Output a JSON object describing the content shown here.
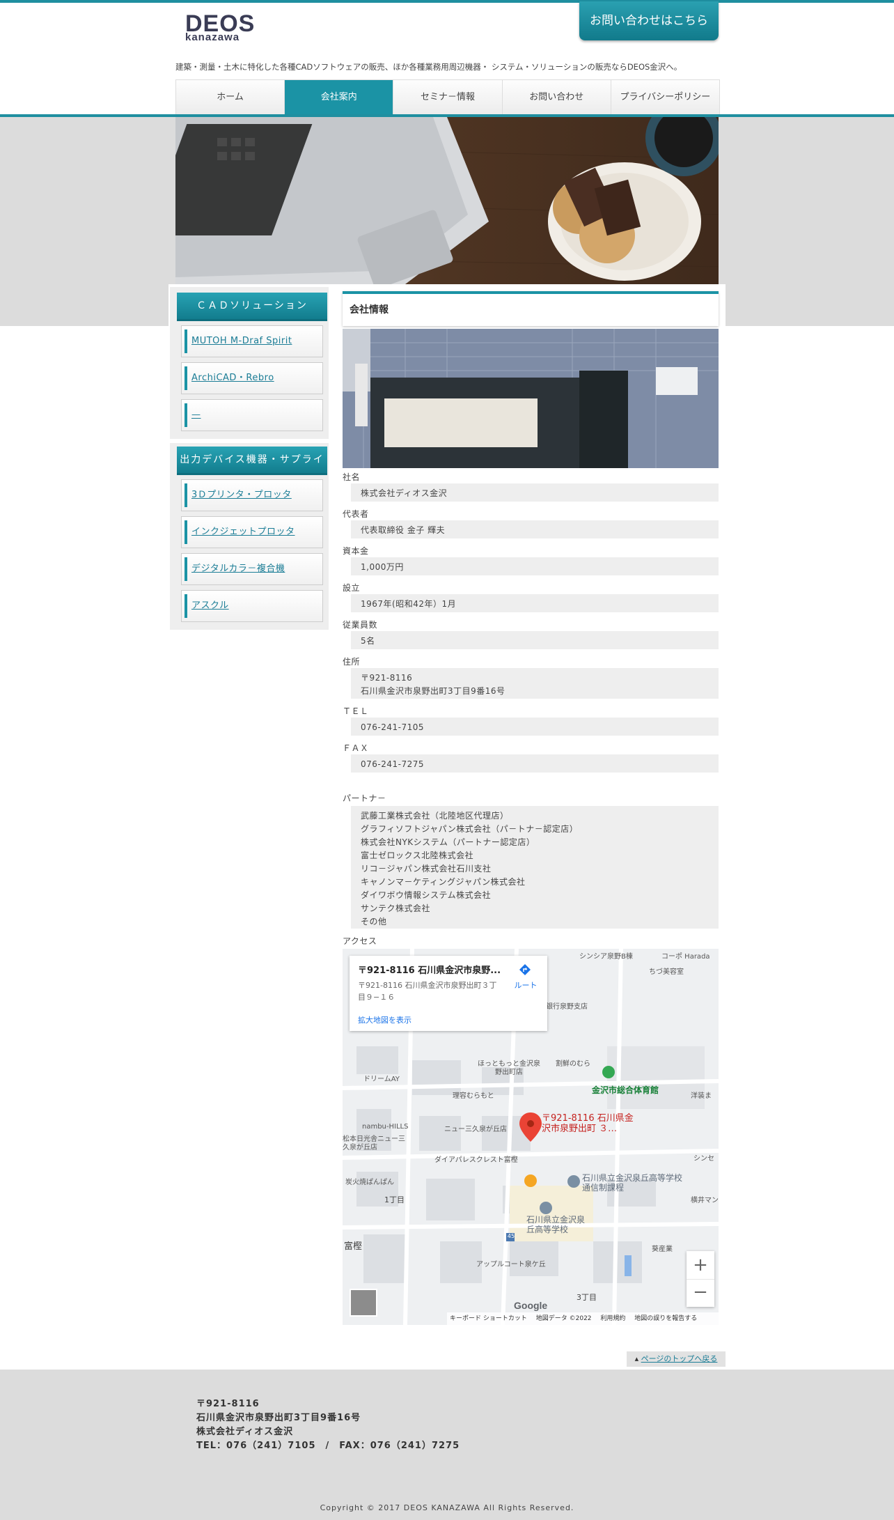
{
  "header": {
    "logo_line1": "DEOS",
    "logo_line2": "kanazawa",
    "contact_button": "お問い合わせはこちら",
    "tagline": "建築・測量・土木に特化した各種CADソフトウェアの販売、ほか各種業務用周辺機器・ システム・ソリューションの販売ならDEOS金沢へ。"
  },
  "nav": [
    {
      "label": "ホーム"
    },
    {
      "label": "会社案内",
      "active": true
    },
    {
      "label": "セミナ－情報"
    },
    {
      "label": "お問い合わせ"
    },
    {
      "label": "プライバシーポリシー"
    }
  ],
  "sidebar": {
    "section1_title": "ＣＡＤソリューション",
    "section1_items": [
      "MUTOH M-Draf Spirit",
      "ArchiCAD・Rebro",
      "—"
    ],
    "section2_title": "出力デバイス機器・サプライ",
    "section2_items": [
      "3Ｄプリンタ・プロッタ",
      "インクジェットプロッタ",
      "デジタルカラ－複合機",
      "アスクル"
    ]
  },
  "main": {
    "title": "会社情報",
    "rows": [
      {
        "label": "社名",
        "value": [
          "株式会社ディオス金沢"
        ]
      },
      {
        "label": "代表者",
        "value": [
          "代表取締役 金子 輝夫"
        ]
      },
      {
        "label": "資本金",
        "value": [
          "1,000万円"
        ]
      },
      {
        "label": "設立",
        "value": [
          "1967年(昭和42年）1月"
        ]
      },
      {
        "label": "従業員数",
        "value": [
          "5名"
        ]
      },
      {
        "label": "住所",
        "value": [
          "〒921-8116",
          "石川県金沢市泉野出町3丁目9番16号"
        ]
      },
      {
        "label": "ＴＥＬ",
        "value": [
          "076-241-7105"
        ]
      },
      {
        "label": "ＦＡＸ",
        "value": [
          "076-241-7275"
        ]
      },
      {
        "label": "パートナ－",
        "value": [
          "武藤工業株式会社（北陸地区代理店）",
          "グラフィソフトジャパン株式会社（パ－トナ－認定店）",
          "株式会社NYKシステム（パートナー認定店）",
          "富士ゼロックス北陸株式会社",
          "リコ－ジャパン株式会社石川支社",
          "キャノンマ－ケティングジャパン株式会社",
          "ダイワボウ情報システム株式会社",
          "サンテク株式会社",
          "その他"
        ]
      },
      {
        "label": "アクセス",
        "value": []
      }
    ]
  },
  "map": {
    "popup_title": "〒921-8116 石川県金沢市泉野...",
    "popup_address": "〒921-8116 石川県金沢市泉野出町３丁目９−１６",
    "popup_link": "拡大地図を表示",
    "route_label": "ルート",
    "marker_label": "〒921-8116 石川県金沢市泉野出町 ３…",
    "places": [
      "シンシア泉野B棟",
      "コーポ Harada",
      "ちづ美容室",
      "銀行泉野支店",
      "ほっともっと金沢泉野出町店",
      "割鮮のむら",
      "金沢市総合体育館",
      "ドリームAY",
      "理容むらもと",
      "洋装ま",
      "nambu-HILLS",
      "ニュー三久泉が丘店",
      "松本日光舎ニュー三久泉が丘店",
      "ダイアパレスクレスト富樫",
      "炭火焼ぱんぱん",
      "石川県立金沢泉丘高等学校 通信制課程",
      "横井マン",
      "1丁目",
      "石川県立金沢泉丘高等学校",
      "富樫",
      "葵産業",
      "アップルコート泉ケ丘",
      "3丁目",
      "シンセ"
    ],
    "footer_links": [
      "キーボード ショートカット",
      "地図データ ©2022",
      "利用規約",
      "地図の誤りを報告する"
    ],
    "google": "Google",
    "road_number": "45"
  },
  "back_to_top": "ページのトップへ戻る",
  "footer": {
    "lines": [
      "〒921-8116",
      "石川県金沢市泉野出町3丁目9番16号",
      "株式会社ディオス金沢",
      "TEL：076（241）7105　/　FAX：076（241）7275"
    ],
    "copyright": "Copyright © 2017 DEOS KANAZAWA All Rights Reserved."
  },
  "colors": {
    "accent": "#1b93a5",
    "accent_dark": "#127d8e",
    "gray_band": "#dcdcdc"
  }
}
